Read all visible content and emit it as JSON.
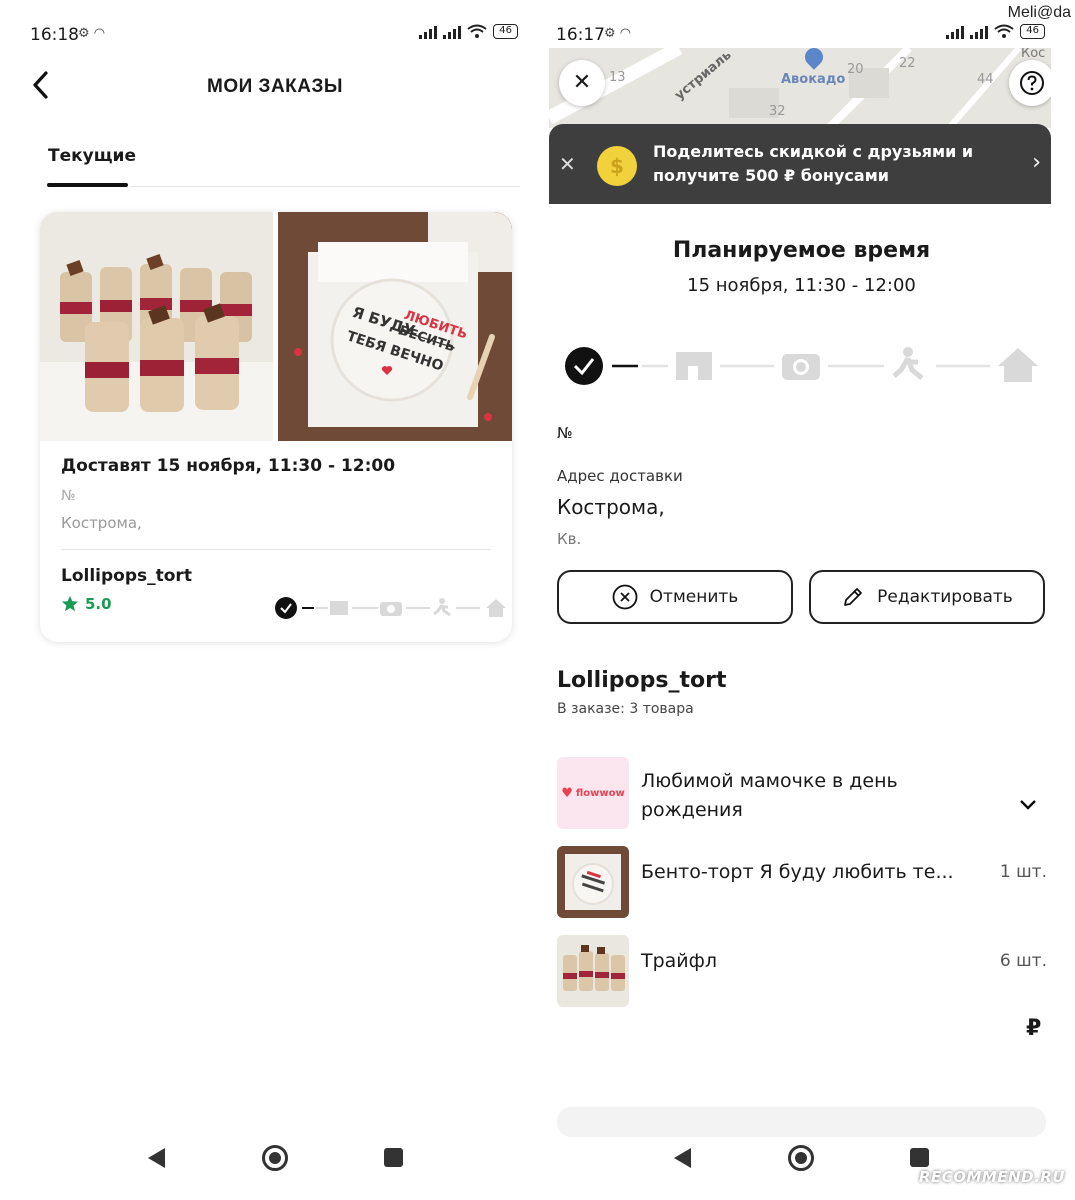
{
  "watermark": "Meli@da",
  "footer_logo": "RECOMMEND.RU",
  "left_screen": {
    "status": {
      "time": "16:18",
      "battery": "46"
    },
    "header": {
      "title": "МОИ ЗАКАЗЫ"
    },
    "tabs": [
      {
        "label": "Текущие",
        "active": true
      }
    ],
    "order": {
      "delivery": "Доставят 15 ноября, 11:30 - 12:00",
      "number_prefix": "№",
      "city": "Кострома,",
      "shop": "Lollipops_tort",
      "rating": "5.0",
      "photos": [
        "trifle-cups-photo",
        "bento-cake-photo"
      ],
      "bento_text": [
        "Я БУДУ",
        "ЛЮБИТЬ",
        "БЕСИТЬ",
        "ТЕБЯ ВЕЧНО"
      ]
    }
  },
  "right_screen": {
    "status": {
      "time": "16:17",
      "battery": "46"
    },
    "map": {
      "label": "Авокадо",
      "street": "устриаль",
      "numbers": [
        "13",
        "20",
        "22",
        "32",
        "44"
      ],
      "corner": "Кос"
    },
    "promo": {
      "text": "Поделитесь скидкой с друзьями и получите 500 ₽ бонусами",
      "coin": "$"
    },
    "planned": {
      "title": "Планируемое время",
      "time": "15 ноября, 11:30 - 12:00"
    },
    "order_number_label": "№",
    "address": {
      "label": "Адрес доставки",
      "city": "Кострома,",
      "apartment_label": "Кв."
    },
    "buttons": {
      "cancel": "Отменить",
      "edit": "Редактировать"
    },
    "store": {
      "name": "Lollipops_tort",
      "count": "В заказе: 3 товара"
    },
    "items": [
      {
        "name": "Любимой мамочке в день рождения",
        "qty": "",
        "thumb_text": "flowwow"
      },
      {
        "name": "Бенто-торт Я буду любить те...",
        "qty": "1 шт."
      },
      {
        "name": "Трайфл",
        "qty": "6 шт."
      }
    ],
    "currency": "₽"
  },
  "colors": {
    "rating_green": "#1a9b55",
    "promo_bg": "#3e3e3e",
    "coin": "#f2d23c",
    "flowwow_red": "#e8424f",
    "track_inactive": "#d9d9d9"
  }
}
